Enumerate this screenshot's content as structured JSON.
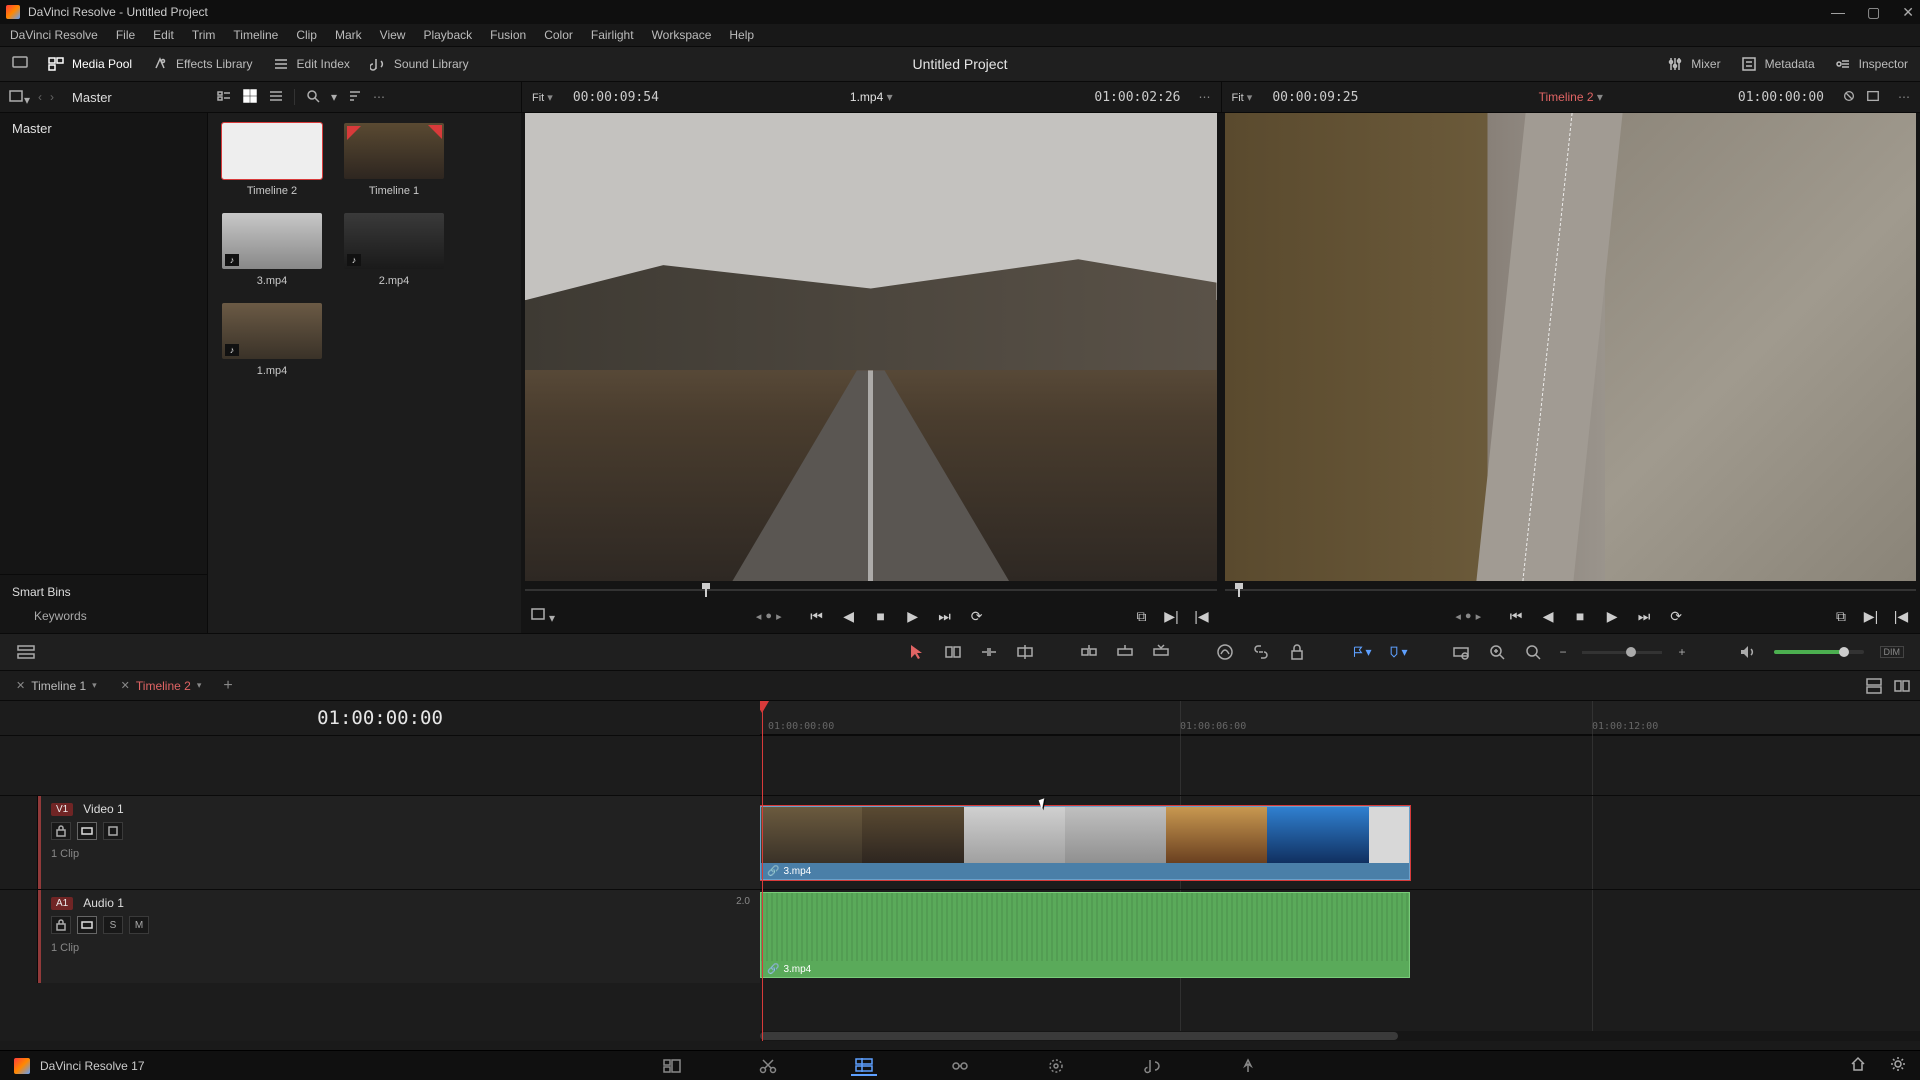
{
  "titlebar": {
    "title": "DaVinci Resolve - Untitled Project"
  },
  "menu": [
    "DaVinci Resolve",
    "File",
    "Edit",
    "Trim",
    "Timeline",
    "Clip",
    "Mark",
    "View",
    "Playback",
    "Fusion",
    "Color",
    "Fairlight",
    "Workspace",
    "Help"
  ],
  "topbar": {
    "media_pool": "Media Pool",
    "effects": "Effects Library",
    "edit_index": "Edit Index",
    "sound_library": "Sound Library",
    "project": "Untitled Project",
    "mixer": "Mixer",
    "metadata": "Metadata",
    "inspector": "Inspector"
  },
  "bin_bar": {
    "master": "Master"
  },
  "sidebar": {
    "master": "Master",
    "smart_title": "Smart Bins",
    "keywords": "Keywords"
  },
  "pool": {
    "items": [
      {
        "name": "Timeline 2"
      },
      {
        "name": "Timeline 1"
      },
      {
        "name": "3.mp4"
      },
      {
        "name": "2.mp4"
      },
      {
        "name": "1.mp4"
      }
    ]
  },
  "source": {
    "fit": "Fit",
    "tc_left": "00:00:09:54",
    "clip": "1.mp4",
    "tc_right": "01:00:02:26"
  },
  "timeline_viewer": {
    "fit": "Fit",
    "tc_left": "00:00:09:25",
    "clip": "Timeline 2",
    "tc_right": "01:00:00:00"
  },
  "tabs": [
    {
      "name": "Timeline 1",
      "active": false
    },
    {
      "name": "Timeline 2",
      "active": true
    }
  ],
  "timeline": {
    "tc": "01:00:00:00",
    "video": {
      "badge": "V1",
      "name": "Video 1",
      "meta": "1 Clip",
      "clip": "3.mp4"
    },
    "audio": {
      "badge": "A1",
      "name": "Audio 1",
      "chan": "2.0",
      "meta": "1 Clip",
      "clip": "3.mp4",
      "solo": "S",
      "mute": "M"
    },
    "ruler": [
      "01:00:00:00",
      "01:00:06:00",
      "01:00:12:00"
    ]
  },
  "status": {
    "app": "DaVinci Resolve 17"
  },
  "dim_label": "DIM"
}
